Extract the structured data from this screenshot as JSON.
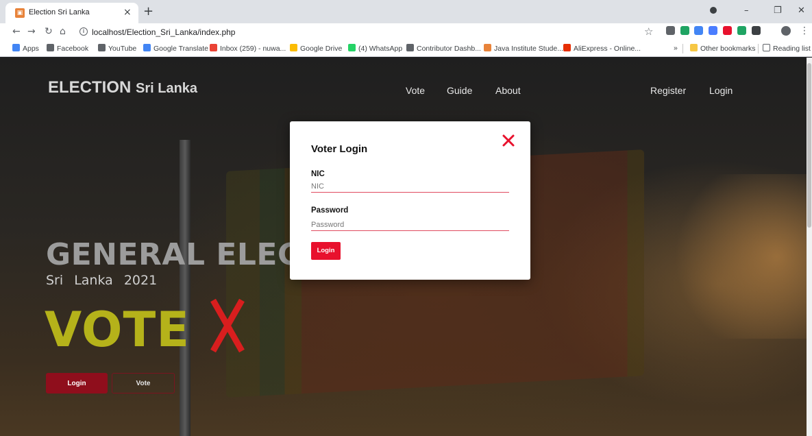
{
  "browser": {
    "tab_title": "Election Sri Lanka",
    "tab_close": "×",
    "new_tab": "+",
    "url": "localhost/Election_Sri_Lanka/index.php",
    "bookmarks": [
      {
        "label": "Apps",
        "color": "#4285f4"
      },
      {
        "label": "Facebook",
        "color": "#5f6368"
      },
      {
        "label": "YouTube",
        "color": "#5f6368"
      },
      {
        "label": "Google Translate",
        "color": "#4285f4"
      },
      {
        "label": "Inbox (259) - nuwa...",
        "color": "#ea4335"
      },
      {
        "label": "Google Drive",
        "color": "#fbbc04"
      },
      {
        "label": "(4) WhatsApp",
        "color": "#25d366"
      },
      {
        "label": "Contributor Dashb...",
        "color": "#5f6368"
      },
      {
        "label": "Java Institute Stude...",
        "color": "#e8833a"
      },
      {
        "label": "AliExpress - Online...",
        "color": "#e62e04"
      }
    ],
    "overflow": "»",
    "other_bookmarks": "Other bookmarks",
    "reading_list": "Reading list",
    "extension_colors": [
      "#5f6368",
      "#1fa463",
      "#4285f4",
      "#4a7dff",
      "#e8112d",
      "#1fa463",
      "#3c4043"
    ]
  },
  "site": {
    "logo_main": "ELECTION",
    "logo_sub": "Sri Lanka",
    "nav": {
      "vote": "Vote",
      "guide": "Guide",
      "about": "About",
      "register": "Register",
      "login": "Login"
    }
  },
  "hero": {
    "title": "GENERAL ELECTION",
    "country": "Sri Lanka",
    "year": "2021",
    "vote_word": "VOTE",
    "vote_color": "#b5b21a",
    "x_color": "#d81e1e",
    "login_button": "Login",
    "vote_button": "Vote"
  },
  "modal": {
    "title": "Voter Login",
    "nic_label": "NIC",
    "nic_placeholder": "NIC",
    "nic_value": "",
    "password_label": "Password",
    "password_placeholder": "Password",
    "password_value": "",
    "login_button": "Login",
    "accent_color": "#e8112d"
  }
}
